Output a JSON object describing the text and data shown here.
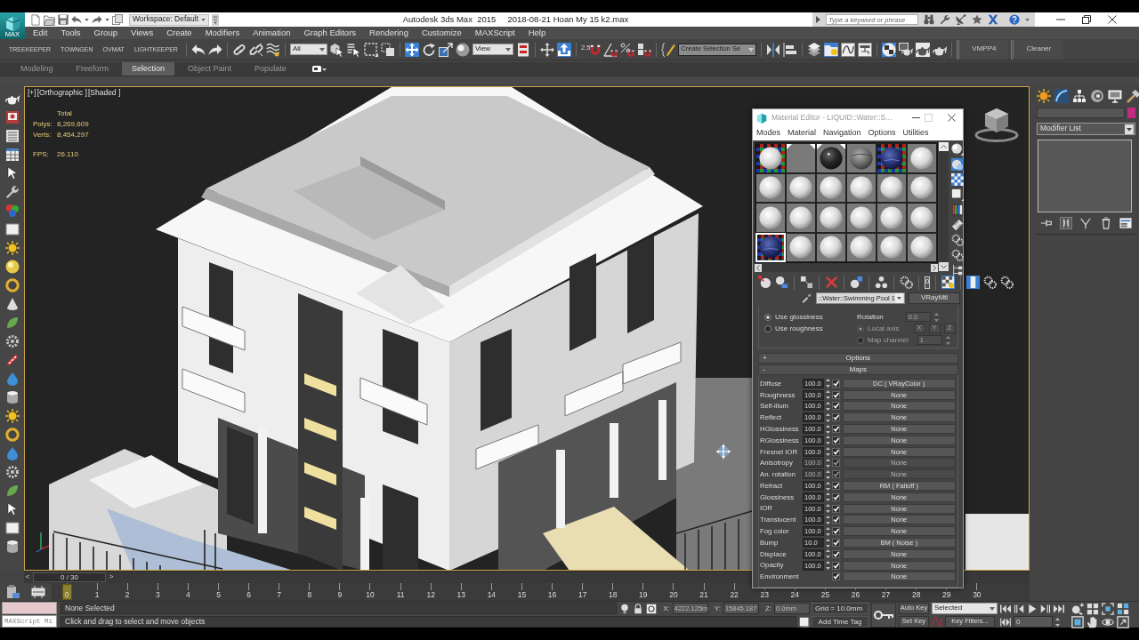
{
  "title_bar": {
    "logo_label": "MAX",
    "workspace": "Workspace: Default",
    "title": "Autodesk 3ds Max  2015     2018-08-21 Hoan My 15 k2.max",
    "search": {
      "placeholder": "Type a keyword or phrase"
    }
  },
  "menu_bar": [
    "Edit",
    "Tools",
    "Group",
    "Views",
    "Create",
    "Modifiers",
    "Animation",
    "Graph Editors",
    "Rendering",
    "Customize",
    "MAXScript",
    "Help"
  ],
  "main_toolbar": {
    "plugin_buttons": [
      "TREEKEEPER",
      "TOWNGEN",
      "OVMAT",
      "LIGHTKEEPER"
    ],
    "selection_filter": "All",
    "move_active": true,
    "reference_coordinate": "View",
    "keyboard_override_active": true,
    "snap_value": "2.5",
    "named_selection": "Create Selection Se",
    "scene_explorer_open": true,
    "material_editor_open": true,
    "script_buttons": [
      "VMPP4",
      "Cleaner"
    ]
  },
  "ribbon_tabs": [
    {
      "label": "Modeling",
      "selected": false
    },
    {
      "label": "Freeform",
      "selected": false
    },
    {
      "label": "Selection",
      "selected": true
    },
    {
      "label": "Object Paint",
      "selected": false
    },
    {
      "label": "Populate",
      "selected": false
    }
  ],
  "viewport": {
    "labels": [
      "[+]",
      "[Orthographic ]",
      "[Shaded ]"
    ],
    "statistics": {
      "heading": "Total",
      "counts": [
        {
          "label": "Polys:",
          "value": "8,269,609"
        },
        {
          "label": "Verts:",
          "value": "8,454,297"
        }
      ],
      "fps": {
        "label": "FPS:",
        "value": "26.110"
      }
    }
  },
  "material_editor": {
    "title": "Material Editor - LIQUID::Water::S...",
    "menu": [
      "Modes",
      "Material",
      "Navigation",
      "Options",
      "Utilities"
    ],
    "slots": [
      {
        "kind": "white",
        "checker": true,
        "in_scene": false,
        "selected": false
      },
      {
        "kind": "flat",
        "checker": false,
        "in_scene": true,
        "selected": false
      },
      {
        "kind": "black",
        "checker": false,
        "in_scene": true,
        "selected": false
      },
      {
        "kind": "stone",
        "checker": false,
        "in_scene": false,
        "selected": false
      },
      {
        "kind": "water",
        "checker": true,
        "in_scene": false,
        "selected": false
      },
      {
        "kind": "white",
        "checker": false,
        "in_scene": false,
        "selected": false
      },
      {
        "kind": "white",
        "checker": false,
        "in_scene": false,
        "selected": false
      },
      {
        "kind": "white",
        "checker": false,
        "in_scene": false,
        "selected": false
      },
      {
        "kind": "white",
        "checker": false,
        "in_scene": false,
        "selected": false
      },
      {
        "kind": "white",
        "checker": false,
        "in_scene": false,
        "selected": false
      },
      {
        "kind": "white",
        "checker": false,
        "in_scene": false,
        "selected": false
      },
      {
        "kind": "white",
        "checker": false,
        "in_scene": false,
        "selected": false
      },
      {
        "kind": "white",
        "checker": false,
        "in_scene": false,
        "selected": false
      },
      {
        "kind": "white",
        "checker": false,
        "in_scene": false,
        "selected": false
      },
      {
        "kind": "white",
        "checker": false,
        "in_scene": false,
        "selected": false
      },
      {
        "kind": "white",
        "checker": false,
        "in_scene": false,
        "selected": false
      },
      {
        "kind": "white",
        "checker": false,
        "in_scene": false,
        "selected": false
      },
      {
        "kind": "white",
        "checker": false,
        "in_scene": false,
        "selected": false
      },
      {
        "kind": "water",
        "checker": true,
        "in_scene": false,
        "selected": true
      },
      {
        "kind": "white",
        "checker": false,
        "in_scene": false,
        "selected": false
      },
      {
        "kind": "white",
        "checker": false,
        "in_scene": false,
        "selected": false
      },
      {
        "kind": "white",
        "checker": false,
        "in_scene": false,
        "selected": false
      },
      {
        "kind": "white",
        "checker": false,
        "in_scene": false,
        "selected": false
      },
      {
        "kind": "white",
        "checker": false,
        "in_scene": false,
        "selected": false
      }
    ],
    "backlight": true,
    "background": true,
    "material_id": "0",
    "show_map": true,
    "show_end_result": true,
    "material_name": "::Water::Swimming Pool 1",
    "material_type": "VRayMtl",
    "brdf": {
      "modes": [
        {
          "label": "Use glossiness",
          "selected": true
        },
        {
          "label": "Use roughness",
          "selected": false
        }
      ],
      "rotation": {
        "label": "Rotation",
        "value": "0.0",
        "disabled": true
      },
      "axis": {
        "disabled": true,
        "options": [
          {
            "label": "Local axis",
            "selected": true
          },
          {
            "label": "Map channel",
            "selected": false
          }
        ],
        "buttons": [
          "X",
          "Y",
          "Z"
        ],
        "channel": "1"
      }
    },
    "rollouts": [
      {
        "sign": "+",
        "label": "Options"
      },
      {
        "sign": "-",
        "label": "Maps"
      }
    ],
    "maps": [
      {
        "name": "Diffuse",
        "amount": "100.0",
        "checked": true,
        "disabled": false,
        "map": "DC ( VRayColor )"
      },
      {
        "name": "Roughness",
        "amount": "100.0",
        "checked": true,
        "disabled": false,
        "map": "None"
      },
      {
        "name": "Self-illum",
        "amount": "100.0",
        "checked": true,
        "disabled": false,
        "map": "None"
      },
      {
        "name": "Reflect",
        "amount": "100.0",
        "checked": true,
        "disabled": false,
        "map": "None"
      },
      {
        "name": "HGlossiness",
        "amount": "100.0",
        "checked": true,
        "disabled": false,
        "map": "None"
      },
      {
        "name": "RGlossiness",
        "amount": "100.0",
        "checked": true,
        "disabled": false,
        "map": "None"
      },
      {
        "name": "Fresnel IOR",
        "amount": "100.0",
        "checked": true,
        "disabled": false,
        "map": "None"
      },
      {
        "name": "Anisotropy",
        "amount": "100.0",
        "checked": true,
        "disabled": true,
        "map": "None"
      },
      {
        "name": "An. rotation",
        "amount": "100.0",
        "checked": true,
        "disabled": true,
        "map": "None"
      },
      {
        "name": "Refract",
        "amount": "100.0",
        "checked": true,
        "disabled": false,
        "map": "RM ( Falloff )"
      },
      {
        "name": "Glossiness",
        "amount": "100.0",
        "checked": true,
        "disabled": false,
        "map": "None"
      },
      {
        "name": "IOR",
        "amount": "100.0",
        "checked": true,
        "disabled": false,
        "map": "None"
      },
      {
        "name": "Translucent",
        "amount": "100.0",
        "checked": true,
        "disabled": false,
        "map": "None"
      },
      {
        "name": "Fog color",
        "amount": "100.0",
        "checked": true,
        "disabled": false,
        "map": "None"
      },
      {
        "name": "Bump",
        "amount": "10.0",
        "checked": true,
        "disabled": false,
        "map": "BM ( Noise )"
      },
      {
        "name": "Displace",
        "amount": "100.0",
        "checked": true,
        "disabled": false,
        "map": "None"
      },
      {
        "name": "Opacity",
        "amount": "100.0",
        "checked": true,
        "disabled": false,
        "map": "None"
      },
      {
        "name": "Environment",
        "checked": true,
        "disabled": false,
        "map": "None"
      }
    ]
  },
  "command_panel": {
    "modifier_list": "Modifier List"
  },
  "time_slider": {
    "previous": "<",
    "position": "0 / 30",
    "next": ">",
    "level": 0
  },
  "track_bar": {
    "ticks": [
      "0",
      "1",
      "2",
      "3",
      "4",
      "5",
      "6",
      "7",
      "8",
      "9",
      "10",
      "11",
      "12",
      "13",
      "14",
      "15",
      "16",
      "17",
      "18",
      "19",
      "20",
      "21",
      "22",
      "23",
      "24",
      "25",
      "26",
      "27",
      "28",
      "29",
      "30"
    ]
  },
  "status_bar": {
    "listener": "MAXScript Mi",
    "selection": "None Selected",
    "prompt": "Click and drag to select and move objects",
    "coordinates": [
      {
        "axis": "X:",
        "value": "4222.125m"
      },
      {
        "axis": "Y:",
        "value": "15845.187"
      },
      {
        "axis": "Z:",
        "value": "0.0mm"
      }
    ],
    "grid": "Grid = 10.0mm",
    "time_tag": "Add Time Tag",
    "auto_key": "Auto Key",
    "key_mode": "Selected",
    "set_key": "Set Key",
    "key_filters": "Key Filters...",
    "frame": "0"
  }
}
